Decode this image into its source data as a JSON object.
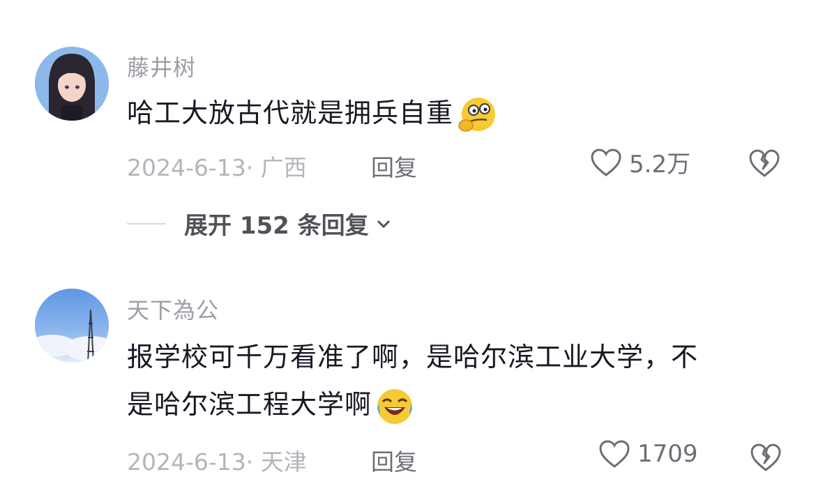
{
  "comments": [
    {
      "username": "藤井树",
      "text": "哈工大放古代就是拥兵自重",
      "emoji": "thinking-face-icon",
      "date_location": "2024-6-13· 广西",
      "reply_label": "回复",
      "likes": "5.2万",
      "expand_label": "展开 152 条回复"
    },
    {
      "username": "天下為公",
      "text_line1": "报学校可千万看准了啊，是哈尔滨工业大学，不",
      "text_line2": "是哈尔滨工程大学啊",
      "emoji": "laughing-crying-face-icon",
      "date_location": "2024-6-13· 天津",
      "reply_label": "回复",
      "likes": "1709"
    }
  ],
  "colors": {
    "text": "#161823",
    "secondary": "#9b9ea6",
    "meta": "#b3b5bb",
    "action": "#6b6e76"
  }
}
